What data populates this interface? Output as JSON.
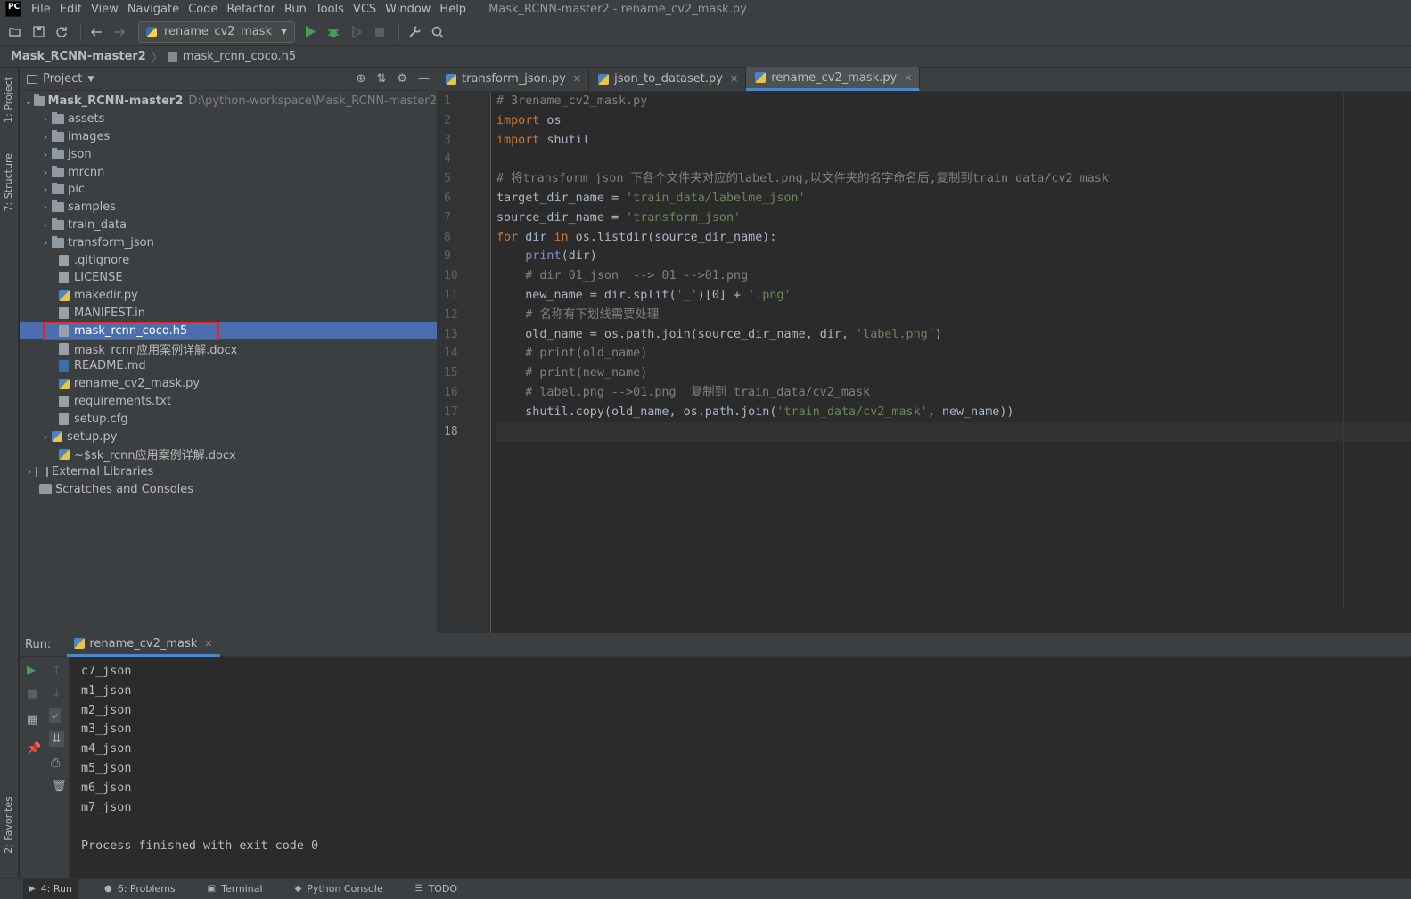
{
  "app": {
    "logo_text": "PC",
    "window_title": "Mask_RCNN-master2 - rename_cv2_mask.py"
  },
  "menu": [
    "File",
    "Edit",
    "View",
    "Navigate",
    "Code",
    "Refactor",
    "Run",
    "Tools",
    "VCS",
    "Window",
    "Help"
  ],
  "toolbar": {
    "run_config": "rename_cv2_mask",
    "icons": [
      "open-folder-icon",
      "save-icon",
      "sync-icon",
      "back-icon",
      "forward-icon",
      "run-icon",
      "debug-icon",
      "coverage-icon",
      "stop-icon",
      "settings-wrench-icon",
      "search-icon"
    ]
  },
  "breadcrumb": {
    "root": "Mask_RCNN-master2",
    "file": "mask_rcnn_coco.h5"
  },
  "side_tabs": {
    "project": "1: Project",
    "structure": "7: Structure",
    "favorites": "2: Favorites"
  },
  "project_panel": {
    "title": "Project",
    "root": {
      "label": "Mask_RCNN-master2",
      "path": "D:\\python-workspace\\Mask_RCNN-master2"
    },
    "items": [
      {
        "label": "assets",
        "kind": "folder"
      },
      {
        "label": "images",
        "kind": "folder"
      },
      {
        "label": "json",
        "kind": "folder"
      },
      {
        "label": "mrcnn",
        "kind": "folder"
      },
      {
        "label": "pic",
        "kind": "folder"
      },
      {
        "label": "samples",
        "kind": "folder"
      },
      {
        "label": "train_data",
        "kind": "folder"
      },
      {
        "label": "transform_json",
        "kind": "folder"
      },
      {
        "label": ".gitignore",
        "kind": "file"
      },
      {
        "label": "LICENSE",
        "kind": "file"
      },
      {
        "label": "makedir.py",
        "kind": "py"
      },
      {
        "label": "MANIFEST.in",
        "kind": "file"
      },
      {
        "label": "mask_rcnn_coco.h5",
        "kind": "file",
        "selected": true
      },
      {
        "label": "mask_rcnn应用案例详解.docx",
        "kind": "file"
      },
      {
        "label": "README.md",
        "kind": "file"
      },
      {
        "label": "rename_cv2_mask.py",
        "kind": "py"
      },
      {
        "label": "requirements.txt",
        "kind": "file"
      },
      {
        "label": "setup.cfg",
        "kind": "file"
      },
      {
        "label": "setup.py",
        "kind": "py"
      },
      {
        "label": "~$sk_rcnn应用案例详解.docx",
        "kind": "file"
      }
    ],
    "external_libraries": "External Libraries",
    "scratches": "Scratches and Consoles"
  },
  "editor": {
    "tabs": [
      {
        "label": "transform_json.py",
        "active": false
      },
      {
        "label": "json_to_dataset.py",
        "active": false
      },
      {
        "label": "rename_cv2_mask.py",
        "active": true
      }
    ],
    "line_numbers": [
      "1",
      "2",
      "3",
      "4",
      "5",
      "6",
      "7",
      "8",
      "9",
      "10",
      "11",
      "12",
      "13",
      "14",
      "15",
      "16",
      "17",
      "18"
    ],
    "current_line": "18",
    "lines": [
      "# 3rename_cv2_mask.py",
      "import os",
      "import shutil",
      "",
      "# 将transform_json 下各个文件夹对应的label.png,以文件夹的名字命名后,复制到train_data/cv2_mask",
      "target_dir_name = 'train_data/labelme_json'",
      "source_dir_name = 'transform_json'",
      "for dir in os.listdir(source_dir_name):",
      "    print(dir)",
      "    # dir 01_json  --> 01 -->01.png",
      "    new_name = dir.split('_')[0] + '.png'",
      "    # 名称有下划线需要处理",
      "    old_name = os.path.join(source_dir_name, dir, 'label.png')",
      "    # print(old_name)",
      "    # print(new_name)",
      "    # label.png -->01.png  复制到 train_data/cv2_mask",
      "    shutil.copy(old_name, os.path.join('train_data/cv2_mask', new_name))",
      ""
    ]
  },
  "run_panel": {
    "label": "Run:",
    "tab": "rename_cv2_mask",
    "output": [
      "c7_json",
      "m1_json",
      "m2_json",
      "m3_json",
      "m4_json",
      "m5_json",
      "m6_json",
      "m7_json",
      "",
      "Process finished with exit code 0"
    ]
  },
  "statusbar": [
    {
      "label": "4: Run",
      "active": true
    },
    {
      "label": "6: Problems",
      "active": false
    },
    {
      "label": "Terminal",
      "active": false
    },
    {
      "label": "Python Console",
      "active": false
    },
    {
      "label": "TODO",
      "active": false
    }
  ],
  "colors": {
    "selection": "#4b6eaf",
    "highlight_box": "#e0272a",
    "keyword": "#cc7832",
    "string": "#6a8759",
    "comment": "#808080",
    "builtin": "#8888c6"
  }
}
